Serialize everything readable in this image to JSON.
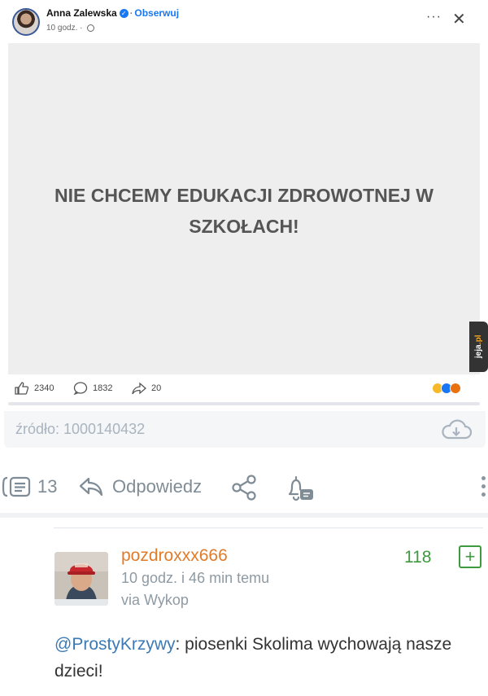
{
  "fb_post": {
    "author": "Anna Zalewska",
    "follow": "Obserwuj",
    "time": "10 godz.",
    "post_text": "NIE CHCEMY EDUKACJI ZDROWOTNEJ W SZKOŁACH!",
    "likes": "2340",
    "comments": "1832",
    "shares": "20",
    "more_icon": "more-horizontal-icon",
    "close_icon": "close-icon"
  },
  "watermark": {
    "text_a": "jeja",
    "text_b": ".pl"
  },
  "source": {
    "label": "źródło: 1000140432",
    "icon": "cloud-download-icon"
  },
  "actions": {
    "comments_count": "13",
    "reply_label": "Odpowiedz",
    "share_icon": "share-icon",
    "notify_icon": "bell-icon",
    "more_icon": "more-vertical-icon"
  },
  "comment": {
    "author": "pozdroxxx666",
    "time": "10 godz. i 46 min temu",
    "via": "via Wykop",
    "score": "118",
    "plus_label": "+",
    "mention": "@ProstyKrzywy",
    "text": ": piosenki Skolima wychowają nasze dzieci!",
    "colors": {
      "author": "#e07b2a",
      "score": "#3e9a3e",
      "mention": "#3c7ab5"
    }
  }
}
